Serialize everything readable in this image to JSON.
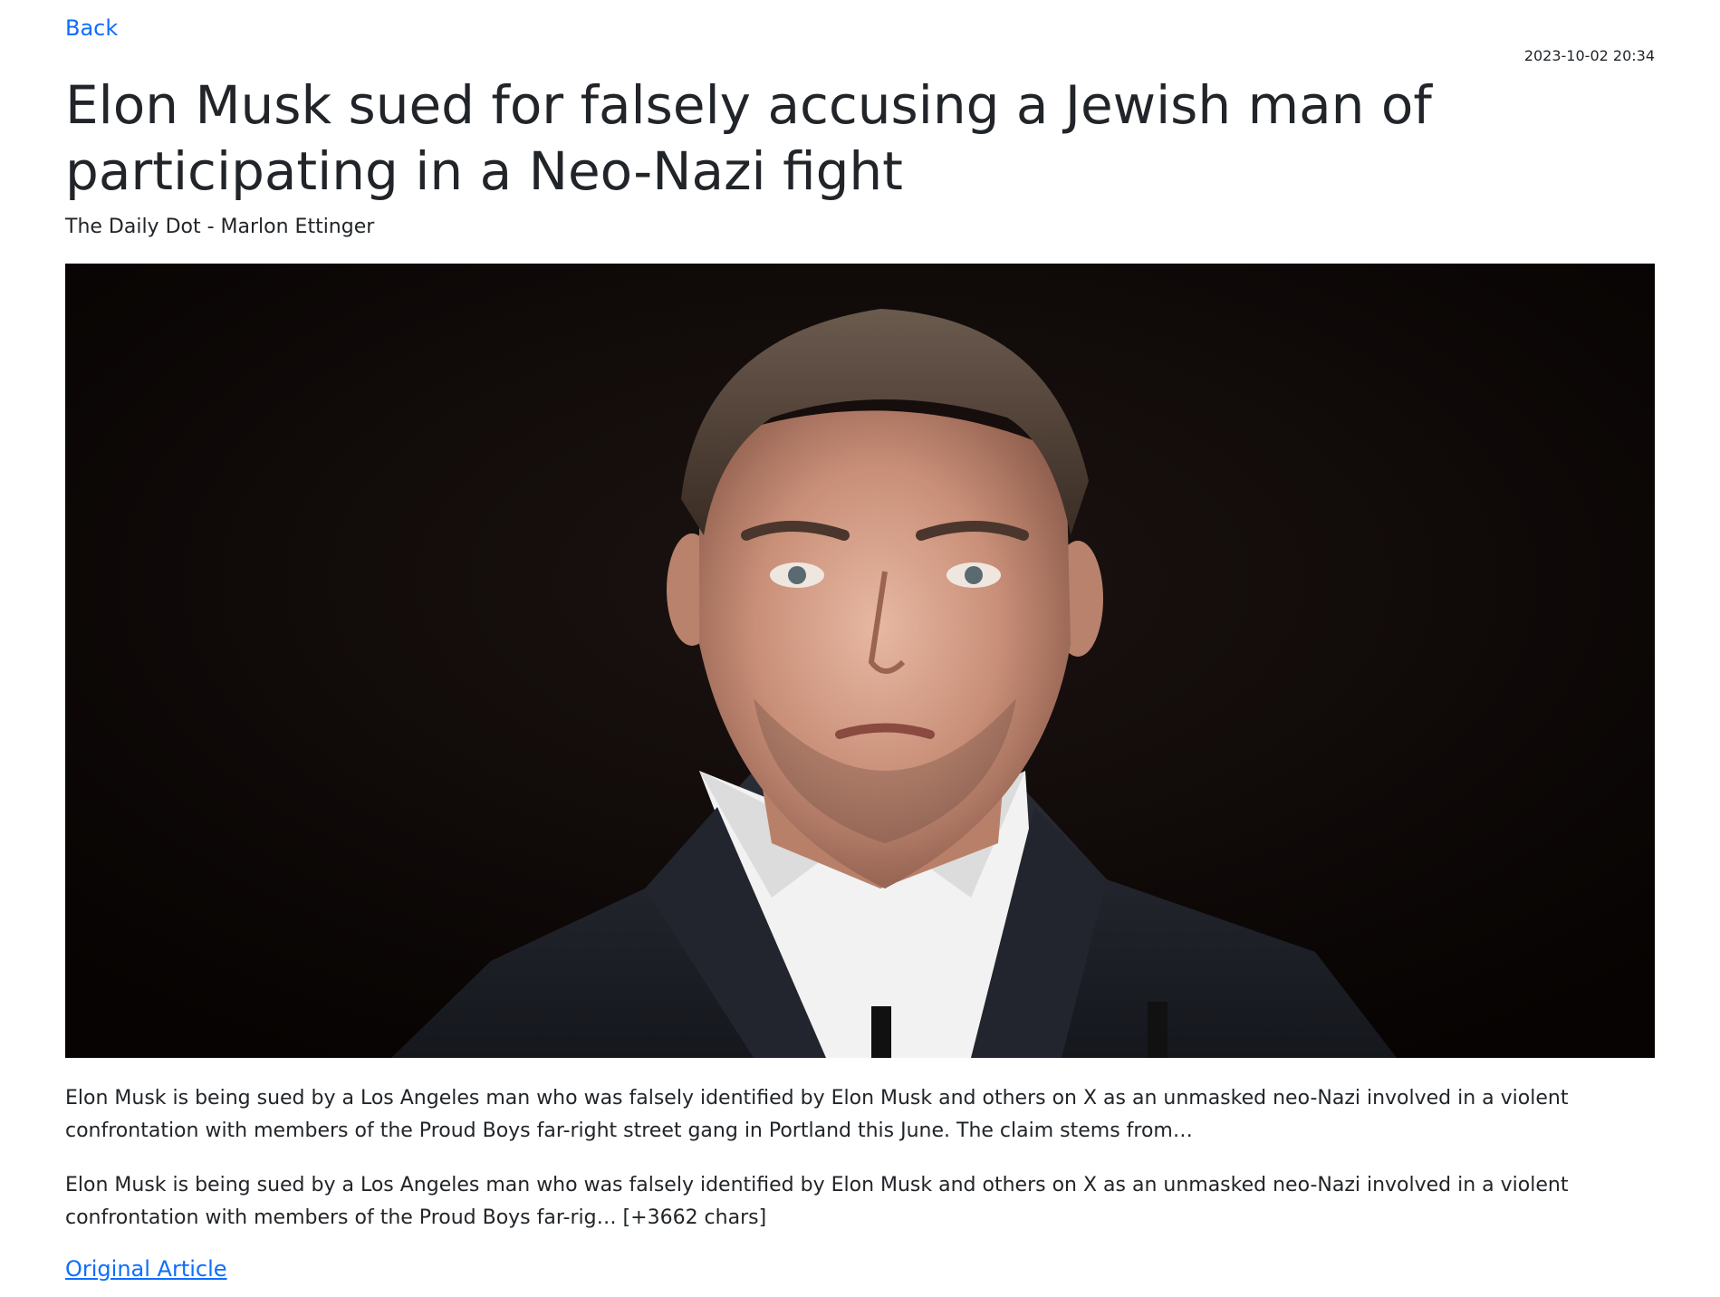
{
  "nav": {
    "back_label": "Back"
  },
  "article": {
    "timestamp": "2023-10-02 20:34",
    "title": "Elon Musk sued for falsely accusing a Jewish man of participating in a Neo-Nazi fight",
    "byline": "The Daily Dot - Marlon Ettinger",
    "description": "Elon Musk is being sued by a Los Angeles man who was falsely identified by Elon Musk and others on X as an unmasked neo-Nazi involved in a violent confrontation with members of the Proud Boys far-right street gang in Portland this June. The claim stems from…",
    "content": "Elon Musk is being sued by a Los Angeles man who was falsely identified by Elon Musk and others on X as an unmasked neo-Nazi involved in a violent confrontation with members of the Proud Boys far-rig… [+3662 chars]",
    "original_link_label": "Original Article"
  },
  "colors": {
    "link": "#0d6efd",
    "text": "#212529",
    "photo_background": "#0c0706"
  }
}
